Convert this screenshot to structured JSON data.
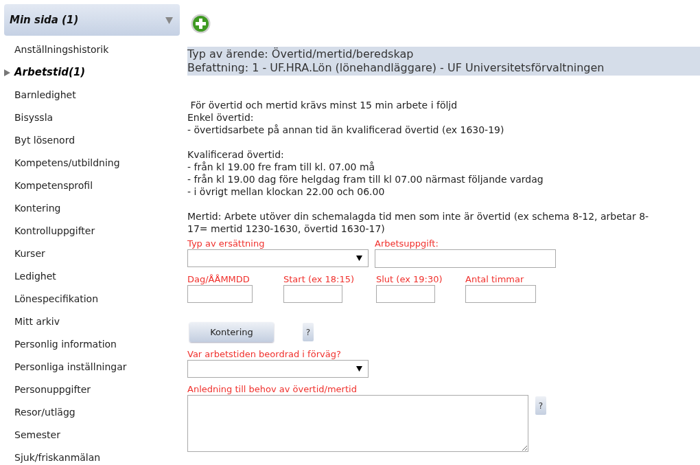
{
  "sidebar": {
    "title": "Min sida (1)",
    "expanded": true,
    "items": [
      {
        "label": "Anställningshistorik",
        "selected": false
      },
      {
        "label": "Arbetstid(1)",
        "selected": true
      },
      {
        "label": "Barnledighet",
        "selected": false
      },
      {
        "label": "Bisyssla",
        "selected": false
      },
      {
        "label": "Byt lösenord",
        "selected": false
      },
      {
        "label": "Kompetens/utbildning",
        "selected": false
      },
      {
        "label": "Kompetensprofil",
        "selected": false
      },
      {
        "label": "Kontering",
        "selected": false
      },
      {
        "label": "Kontrolluppgifter",
        "selected": false
      },
      {
        "label": "Kurser",
        "selected": false
      },
      {
        "label": "Ledighet",
        "selected": false
      },
      {
        "label": "Lönespecifikation",
        "selected": false
      },
      {
        "label": "Mitt arkiv",
        "selected": false
      },
      {
        "label": "Personlig information",
        "selected": false
      },
      {
        "label": "Personliga inställningar",
        "selected": false
      },
      {
        "label": "Personuppgifter",
        "selected": false
      },
      {
        "label": "Resor/utlägg",
        "selected": false
      },
      {
        "label": "Semester",
        "selected": false
      },
      {
        "label": "Sjuk/friskanmälan",
        "selected": false
      }
    ]
  },
  "header": [
    "Typ av ärende: Övertid/mertid/beredskap",
    "Befattning: 1 - UF.HRA.Lön (lönehandläggare) - UF Universitetsförvaltningen"
  ],
  "instructions": [
    [
      " För övertid och mertid krävs minst 15 min arbete i följd",
      "Enkel övertid:",
      "- övertidsarbete på annan tid än kvalificerad övertid (ex 1630-19)"
    ],
    [
      "Kvalificerad övertid:",
      "- från kl 19.00 fre fram till kl. 07.00 må",
      "- från kl 19.00 dag före helgdag fram till kl 07.00 närmast följande vardag",
      "- i övrigt mellan klockan 22.00 och 06.00"
    ],
    [
      "Mertid: Arbete utöver din schemalagda tid men som inte är övertid (ex schema 8-12, arbetar 8-17= mertid 1230-1630, övertid 1630-17)"
    ]
  ],
  "form": {
    "row_1": [
      {
        "kind": "select",
        "label": "Typ av ersättning"
      },
      {
        "kind": "input",
        "label": "Arbetsuppgift:"
      }
    ],
    "row_2": [
      {
        "label": "Dag/ÅÅMMDD"
      },
      {
        "label": "Start (ex 18:15)"
      },
      {
        "label": "Slut (ex 19:30)"
      },
      {
        "label": "Antal timmar"
      }
    ],
    "kontering_button": "Kontering",
    "help_1": "?",
    "ordered_label": "Var arbetstiden beordrad i förväg?",
    "reason_label": "Anledning till behov av övertid/mertid",
    "help_2": "?"
  }
}
